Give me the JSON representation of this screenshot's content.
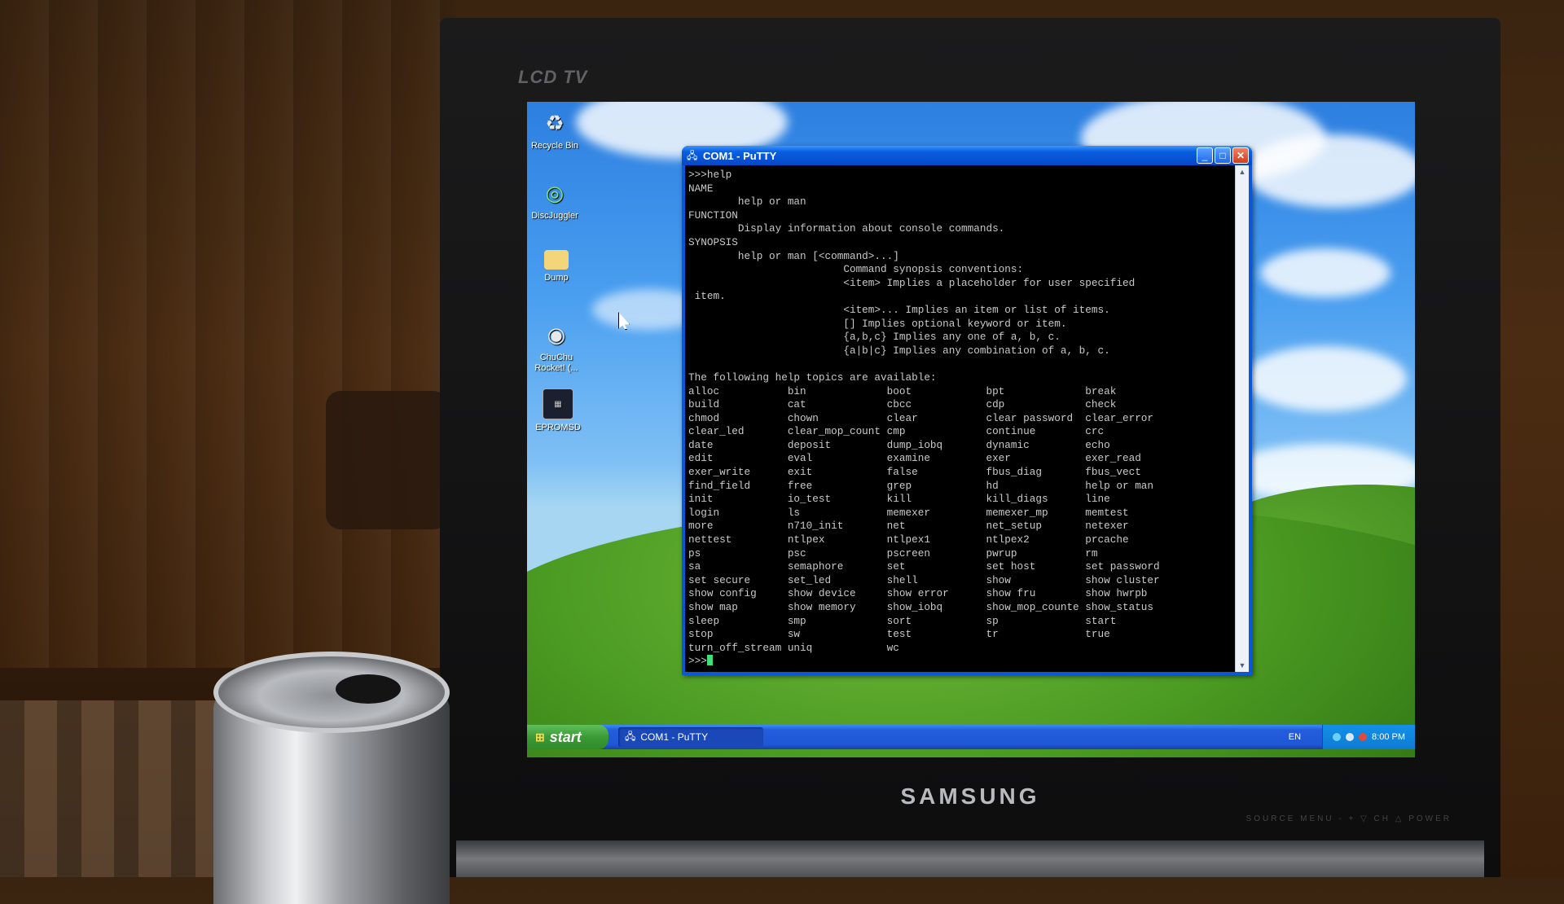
{
  "monitor": {
    "model_badge": "LCD TV",
    "brand": "SAMSUNG",
    "controls": "SOURCE   MENU   -   +   ▽ CH △   POWER"
  },
  "desktop": {
    "icons": [
      {
        "label": "Recycle Bin",
        "icon": "recycle-bin-icon"
      },
      {
        "label": "DiscJuggler",
        "icon": "discjuggler-icon"
      },
      {
        "label": "Dump",
        "icon": "folder-icon"
      },
      {
        "label": "ChuChu Rocket! (...",
        "icon": "chuchu-rocket-icon"
      },
      {
        "label": "EPROMSD",
        "icon": "epromsd-icon"
      }
    ]
  },
  "putty": {
    "title": "COM1 - PuTTY",
    "buttons": {
      "minimize": "_",
      "maximize": "□",
      "close": "✕"
    },
    "output": ">>>help\nNAME\n        help or man\nFUNCTION\n        Display information about console commands.\nSYNOPSIS\n        help or man [<command>...]\n                         Command synopsis conventions:\n                         <item> Implies a placeholder for user specified\n item.\n                         <item>... Implies an item or list of items.\n                         [] Implies optional keyword or item.\n                         {a,b,c} Implies any one of a, b, c.\n                         {a|b|c} Implies any combination of a, b, c.\n\nThe following help topics are available:\nalloc           bin             boot            bpt             break\nbuild           cat             cbcc            cdp             check\nchmod           chown           clear           clear password  clear_error\nclear_led       clear_mop_count cmp             continue        crc\ndate            deposit         dump_iobq       dynamic         echo\nedit            eval            examine         exer            exer_read\nexer_write      exit            false           fbus_diag       fbus_vect\nfind_field      free            grep            hd              help or man\ninit            io_test         kill            kill_diags      line\nlogin           ls              memexer         memexer_mp      memtest\nmore            n710_init       net             net_setup       netexer\nnettest         ntlpex          ntlpex1         ntlpex2         prcache\nps              psc             pscreen         pwrup           rm\nsa              semaphore       set             set host        set password\nset secure      set_led         shell           show            show cluster\nshow config     show device     show error      show fru        show hwrpb\nshow map        show memory     show_iobq       show_mop_counte show_status\nsleep           smp             sort            sp              start\nstop            sw              test            tr              true\nturn_off_stream uniq            wc",
    "prompt": ">>>"
  },
  "taskbar": {
    "start_label": "start",
    "task_label": "COM1 - PuTTY",
    "language": "EN",
    "clock": "8:00 PM"
  }
}
